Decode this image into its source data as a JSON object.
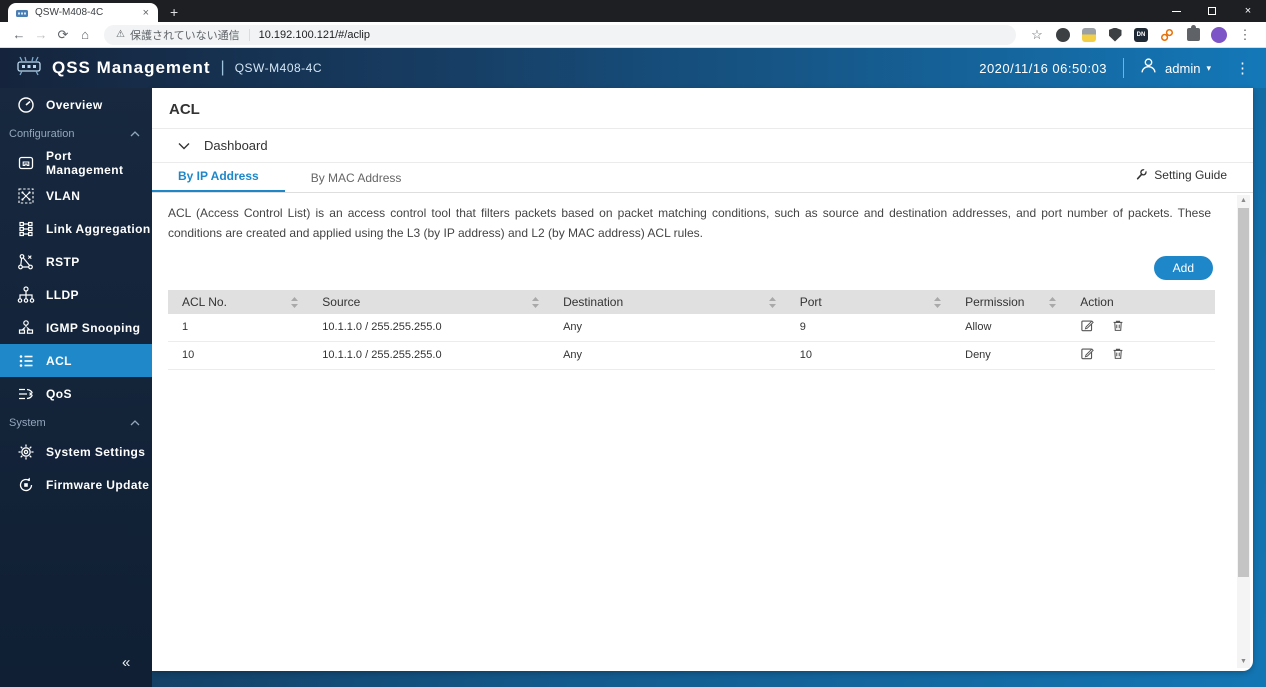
{
  "icons": {
    "close_tab": "×",
    "new_tab": "+",
    "close_window": "×",
    "back": "←",
    "forward": "→",
    "reload": "⟳",
    "home": "⌂",
    "warning": "⚠",
    "star": "☆",
    "menu_kebab": "⋮",
    "caret_down": "▾",
    "collapse": "«",
    "scroll_up": "▲",
    "scroll_down": "▼"
  },
  "browser": {
    "tab_title": "QSW-M408-4C",
    "security_warning": "保護されていない通信",
    "url": "10.192.100.121/#/aclip",
    "extension_badge": "DN"
  },
  "header": {
    "app_title": "QSS Management",
    "separator": "|",
    "device_name": "QSW-M408-4C",
    "datetime": "2020/11/16 06:50:03",
    "user": "admin"
  },
  "sidebar": {
    "sections": {
      "configuration": "Configuration",
      "system": "System"
    },
    "items": [
      {
        "label": "Overview"
      },
      {
        "label": "Port Management"
      },
      {
        "label": "VLAN"
      },
      {
        "label": "Link Aggregation"
      },
      {
        "label": "RSTP"
      },
      {
        "label": "LLDP"
      },
      {
        "label": "IGMP Snooping"
      },
      {
        "label": "ACL",
        "active": true
      },
      {
        "label": "QoS"
      },
      {
        "label": "System Settings"
      },
      {
        "label": "Firmware Update"
      }
    ]
  },
  "main": {
    "page_title": "ACL",
    "panel_title": "Dashboard",
    "tabs": [
      {
        "label": "By IP Address"
      },
      {
        "label": "By MAC Address"
      }
    ],
    "setting_guide": "Setting Guide",
    "description": "ACL (Access Control List) is an access control tool that filters packets based on packet matching conditions, such as source and destination addresses, and port number of packets. These conditions are created and applied using the L3 (by IP address) and L2 (by MAC address) ACL rules.",
    "add_button": "Add",
    "table": {
      "columns": [
        "ACL No.",
        "Source",
        "Destination",
        "Port",
        "Permission",
        "Action"
      ],
      "rows": [
        {
          "acl_no": "1",
          "source": "10.1.1.0 / 255.255.255.0",
          "destination": "Any",
          "port": "9",
          "permission": "Allow"
        },
        {
          "acl_no": "10",
          "source": "10.1.1.0 / 255.255.255.0",
          "destination": "Any",
          "port": "10",
          "permission": "Deny"
        }
      ]
    }
  },
  "colors": {
    "accent_blue": "#1e87c9",
    "active_sidebar_item": "#1e88c9",
    "header_gradient_start": "#15243c",
    "header_gradient_end": "#1478b8",
    "sidebar_bg": "#17283f",
    "table_header_bg": "#e0e0e0",
    "add_button_bg": "#1e87ca"
  }
}
